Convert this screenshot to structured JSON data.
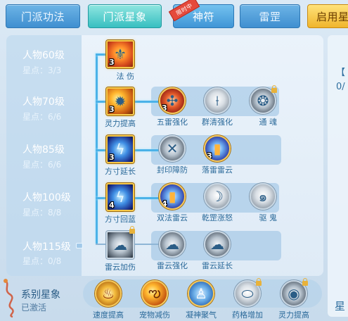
{
  "tabs": [
    {
      "label": "门派功法",
      "state": "inactive"
    },
    {
      "label": "门派星象",
      "state": "active"
    },
    {
      "label": "神符",
      "state": "new",
      "badge": "限时中"
    },
    {
      "label": "雷罡",
      "state": "inactive"
    },
    {
      "label": "启用星",
      "state": "yellow"
    }
  ],
  "tiers": [
    {
      "title": "人物60级",
      "points": "星点：3/3"
    },
    {
      "title": "人物70级",
      "points": "星点：6/6"
    },
    {
      "title": "人物85级",
      "points": "星点：6/6"
    },
    {
      "title": "人物100级",
      "points": "星点：8/8"
    },
    {
      "title": "人物115级",
      "points": "星点：0/8"
    }
  ],
  "skills": {
    "r1": [
      {
        "name": "法 伤",
        "level": "3",
        "icon": "figure-icon"
      }
    ],
    "r2": [
      {
        "name": "灵力提高",
        "level": "3",
        "icon": "flame-burst-icon"
      },
      {
        "name": "五雷强化",
        "level": "3",
        "icon": "red-seal-icon"
      },
      {
        "name": "群清强化",
        "level": "",
        "icon": "sword-icon"
      },
      {
        "name": "通 魂",
        "level": "",
        "icon": "spirit-icon",
        "locked": true
      }
    ],
    "r3": [
      {
        "name": "方寸延长",
        "level": "3",
        "icon": "lightning-icon"
      },
      {
        "name": "封印障防",
        "level": "",
        "icon": "cross-blade-icon"
      },
      {
        "name": "落雷雷云",
        "level": "3",
        "icon": "talisman-icon"
      }
    ],
    "r4": [
      {
        "name": "方寸回蓝",
        "level": "4",
        "icon": "lightning-icon"
      },
      {
        "name": "双法雷云",
        "level": "4",
        "icon": "talisman-icon"
      },
      {
        "name": "乾罡涨怒",
        "level": "",
        "icon": "blade-icon"
      },
      {
        "name": "驱 鬼",
        "level": "",
        "icon": "swirl-icon"
      }
    ],
    "r5": [
      {
        "name": "雷云加伤",
        "level": "",
        "icon": "cloud-icon",
        "locked": true
      },
      {
        "name": "雷云强化",
        "level": "",
        "icon": "cloud-icon"
      },
      {
        "name": "雷云延长",
        "level": "",
        "icon": "cloud-icon"
      }
    ]
  },
  "series": {
    "title": "系别星象",
    "status": "已激活",
    "items": [
      {
        "name": "速度提高",
        "icon": "flame-icon"
      },
      {
        "name": "宠物减伤",
        "icon": "pet-flame-icon"
      },
      {
        "name": "凝神聚气",
        "icon": "meditate-icon"
      },
      {
        "name": "药格增加",
        "icon": "potion-icon",
        "locked": true
      },
      {
        "name": "灵力提高",
        "icon": "orb-icon",
        "locked": true
      }
    ]
  },
  "right": {
    "bracket": "【",
    "frac": "0/",
    "bottom": "星"
  }
}
